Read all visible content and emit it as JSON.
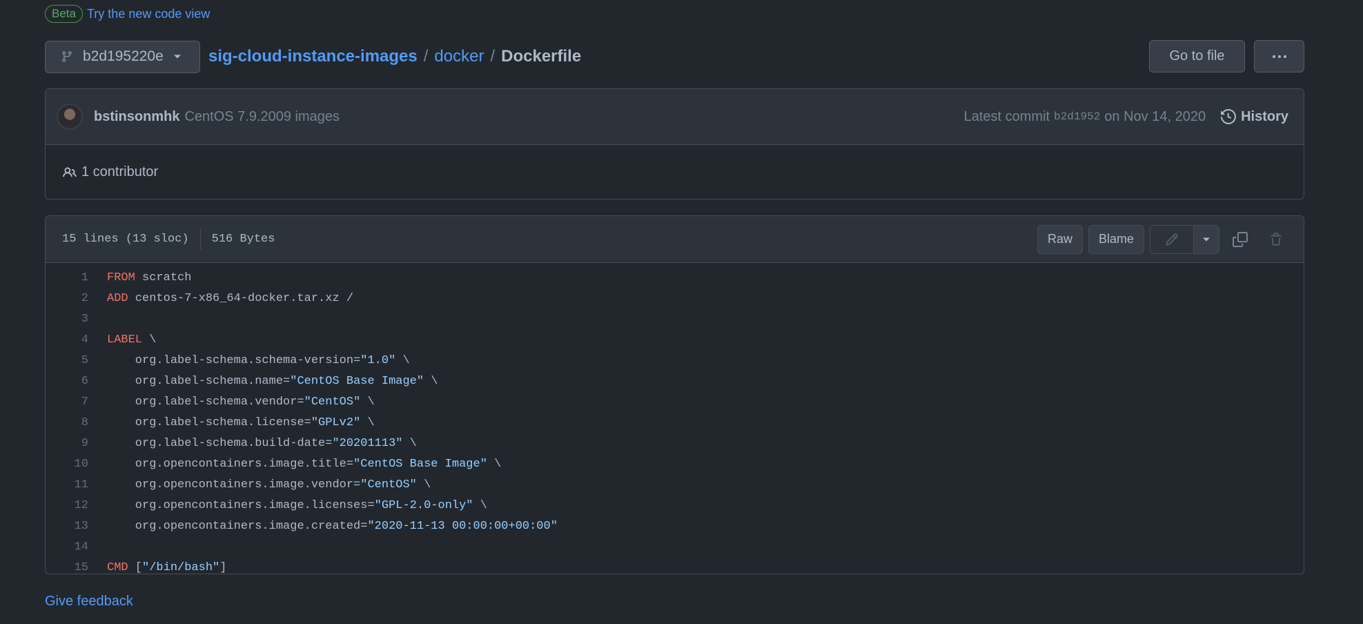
{
  "beta": {
    "badge": "Beta",
    "link": "Try the new code view"
  },
  "branch": {
    "name": "b2d195220e"
  },
  "breadcrumb": {
    "repo": "sig-cloud-instance-images",
    "sep1": "/",
    "dir": "docker",
    "sep2": "/",
    "file": "Dockerfile"
  },
  "header": {
    "goto_label": "Go to file",
    "more_label": "..."
  },
  "commit": {
    "author": "bstinsonmhk",
    "message": "CentOS 7.9.2009 images",
    "latest_prefix": "Latest commit",
    "sha": "b2d1952",
    "date": "on Nov 14, 2020",
    "history_label": "History"
  },
  "contributors": {
    "label": "1 contributor"
  },
  "file_info": {
    "lines": "15 lines (13 sloc)",
    "size": "516 Bytes"
  },
  "file_actions": {
    "raw": "Raw",
    "blame": "Blame"
  },
  "code": {
    "line_numbers": [
      "1",
      "2",
      "3",
      "4",
      "5",
      "6",
      "7",
      "8",
      "9",
      "10",
      "11",
      "12",
      "13",
      "14",
      "15"
    ],
    "lines": [
      [
        {
          "t": "FROM",
          "k": "kw"
        },
        {
          "t": " scratch",
          "k": ""
        }
      ],
      [
        {
          "t": "ADD",
          "k": "kw"
        },
        {
          "t": " centos-7-x86_64-docker.tar.xz /",
          "k": ""
        }
      ],
      [],
      [
        {
          "t": "LABEL",
          "k": "kw"
        },
        {
          "t": " \\",
          "k": ""
        }
      ],
      [
        {
          "t": "    org.label-schema.schema-version=",
          "k": ""
        },
        {
          "t": "\"1.0\"",
          "k": "str"
        },
        {
          "t": " \\",
          "k": ""
        }
      ],
      [
        {
          "t": "    org.label-schema.name=",
          "k": ""
        },
        {
          "t": "\"CentOS Base Image\"",
          "k": "str"
        },
        {
          "t": " \\",
          "k": ""
        }
      ],
      [
        {
          "t": "    org.label-schema.vendor=",
          "k": ""
        },
        {
          "t": "\"CentOS\"",
          "k": "str"
        },
        {
          "t": " \\",
          "k": ""
        }
      ],
      [
        {
          "t": "    org.label-schema.license=",
          "k": ""
        },
        {
          "t": "\"GPLv2\"",
          "k": "str"
        },
        {
          "t": " \\",
          "k": ""
        }
      ],
      [
        {
          "t": "    org.label-schema.build-date=",
          "k": ""
        },
        {
          "t": "\"20201113\"",
          "k": "str"
        },
        {
          "t": " \\",
          "k": ""
        }
      ],
      [
        {
          "t": "    org.opencontainers.image.title=",
          "k": ""
        },
        {
          "t": "\"CentOS Base Image\"",
          "k": "str"
        },
        {
          "t": " \\",
          "k": ""
        }
      ],
      [
        {
          "t": "    org.opencontainers.image.vendor=",
          "k": ""
        },
        {
          "t": "\"CentOS\"",
          "k": "str"
        },
        {
          "t": " \\",
          "k": ""
        }
      ],
      [
        {
          "t": "    org.opencontainers.image.licenses=",
          "k": ""
        },
        {
          "t": "\"GPL-2.0-only\"",
          "k": "str"
        },
        {
          "t": " \\",
          "k": ""
        }
      ],
      [
        {
          "t": "    org.opencontainers.image.created=",
          "k": ""
        },
        {
          "t": "\"2020-11-13 00:00:00+00:00\"",
          "k": "str"
        }
      ],
      [],
      [
        {
          "t": "CMD",
          "k": "kw"
        },
        {
          "t": " [",
          "k": ""
        },
        {
          "t": "\"/bin/bash\"",
          "k": "str"
        },
        {
          "t": "]",
          "k": ""
        }
      ]
    ]
  },
  "footer": {
    "feedback": "Give feedback"
  }
}
